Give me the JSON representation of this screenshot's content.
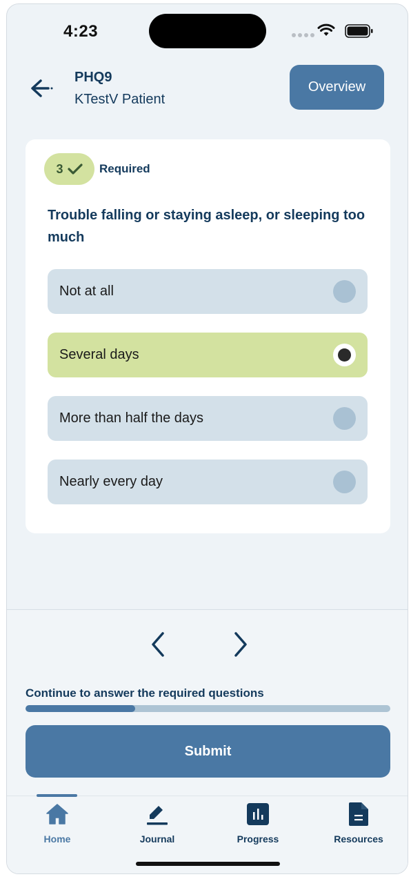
{
  "status_bar": {
    "time": "4:23"
  },
  "header": {
    "title": "PHQ9",
    "subtitle": "KTestV Patient",
    "overview_label": "Overview"
  },
  "question": {
    "badge_count": "3",
    "required_label": "Required",
    "text": "Trouble falling or staying asleep, or sleeping too much",
    "options": [
      {
        "label": "Not at all",
        "selected": false
      },
      {
        "label": "Several days",
        "selected": true
      },
      {
        "label": "More than half the days",
        "selected": false
      },
      {
        "label": "Nearly every day",
        "selected": false
      }
    ]
  },
  "footer": {
    "progress_caption": "Continue to answer the required questions",
    "progress_fraction": 0.3,
    "submit_label": "Submit"
  },
  "tabbar": {
    "tabs": [
      {
        "label": "Home",
        "icon": "home-icon",
        "active": true
      },
      {
        "label": "Journal",
        "icon": "pencil-icon",
        "active": false
      },
      {
        "label": "Progress",
        "icon": "chart-icon",
        "active": false
      },
      {
        "label": "Resources",
        "icon": "document-icon",
        "active": false
      }
    ]
  },
  "colors": {
    "primary": "#4a78a4",
    "text_dark": "#143a5c",
    "selected_bg": "#d3e2a0",
    "option_bg": "#d3e0e9",
    "screen_bg": "#eef3f7"
  }
}
